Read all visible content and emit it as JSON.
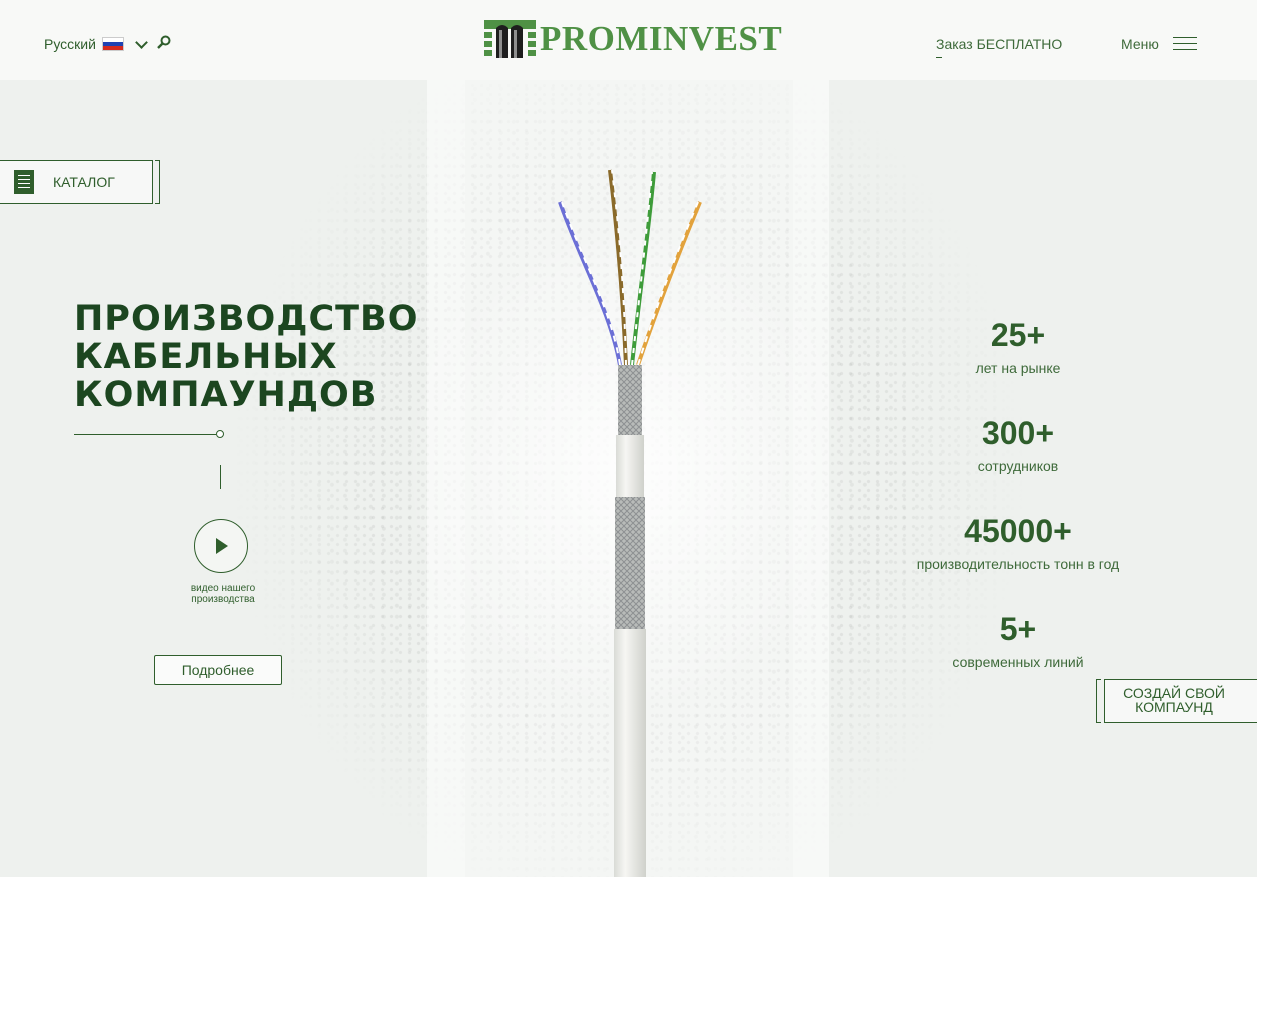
{
  "header": {
    "language": "Русский",
    "logo_text": "PROMINVEST",
    "order_link": "Заказ БЕСПЛАТНО",
    "menu_label": "Меню"
  },
  "catalog": {
    "label": "КАТАЛОГ"
  },
  "hero": {
    "headline_lines": [
      "ПРОИЗВОДСТВО",
      "КАБЕЛЬНЫХ",
      "КОМПАУНДОВ"
    ],
    "video_caption": "видео нашего производства",
    "more_button": "Подробнее"
  },
  "stats": [
    {
      "value": "25+",
      "label": "лет на рынке"
    },
    {
      "value": "300+",
      "label": "сотрудников"
    },
    {
      "value": "45000+",
      "label": "производительность тонн в год"
    },
    {
      "value": "5+",
      "label": "современных линий"
    }
  ],
  "create_button": {
    "line1": "СОЗДАЙ СВОЙ",
    "line2": "КОМПАУНД"
  },
  "colors": {
    "brand_green": "#4f9145",
    "dark_green": "#1c4620",
    "text_green": "#2f5e2c"
  }
}
